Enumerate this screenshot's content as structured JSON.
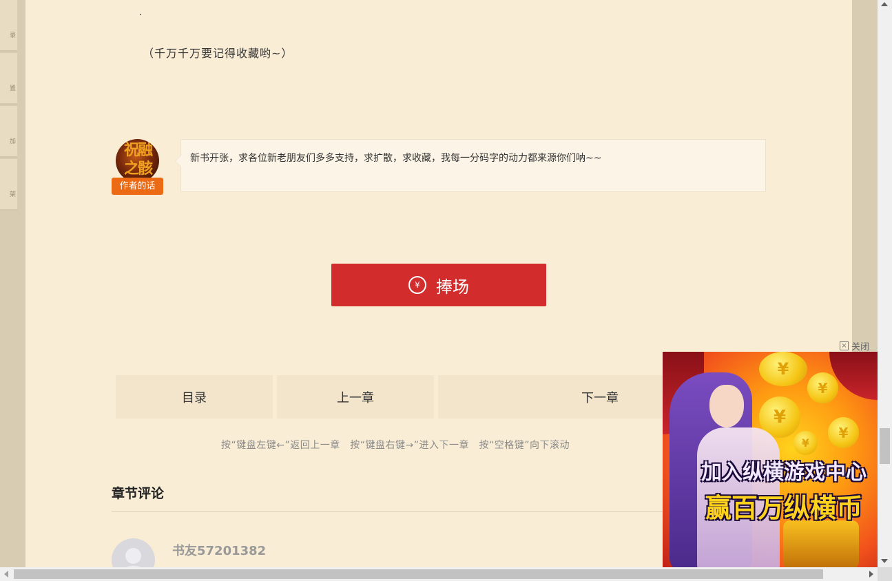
{
  "left_toolbar": {
    "glyphs": [
      "录",
      "置",
      "加",
      "架"
    ]
  },
  "chapter": {
    "dot": "·",
    "tail_text": "（千万千万要记得收藏哟~）"
  },
  "author_note": {
    "avatar_text": "祝融之骸",
    "badge": "作者的话",
    "message": "新书开张，求各位新老朋友们多多支持，求扩散，求收藏，我每一分码字的动力都来源你们呐~~"
  },
  "support_button": {
    "icon": "yen-icon",
    "icon_glyph": "¥",
    "label": "捧场"
  },
  "nav": {
    "toc": "目录",
    "prev": "上一章",
    "next": "下一章",
    "hint": "按“键盘左键←”返回上一章　按“键盘右键→”进入下一章　按“空格键”向下滚动"
  },
  "comments": {
    "title": "章节评论",
    "first_user": "书友57201382"
  },
  "ad": {
    "close_label": "关闭",
    "close_icon": "close-icon",
    "line1": "加入纵横游戏中心",
    "line2": "赢百万纵横币",
    "coin_glyph": "¥"
  },
  "colors": {
    "page_bg": "#faedd6",
    "side_bg": "#d8ccb3",
    "support_red": "#d22c2c",
    "badge_orange": "#ec6a14"
  }
}
